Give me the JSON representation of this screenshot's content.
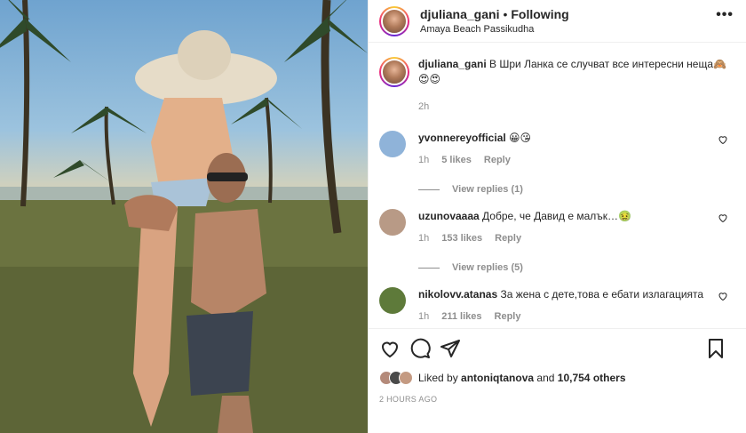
{
  "post": {
    "username": "djuliana_gani",
    "dot": "•",
    "follow_label": "Following",
    "location": "Amaya Beach Passikudha",
    "more_label": "•••",
    "caption_user": "djuliana_gani",
    "caption_text": "В Шри Ланка се случват все интересни неща🙈😍😍",
    "caption_time": "2h"
  },
  "comments": [
    {
      "user": "yvonnereyofficial",
      "text": "😀😘",
      "time": "1h",
      "likes": "5 likes",
      "reply": "Reply",
      "view_replies": "View replies (1)",
      "avatar_color": "#8fb3d9"
    },
    {
      "user": "uzunovaaaa",
      "text": "Добре, че Давид е малък…🤢",
      "time": "1h",
      "likes": "153 likes",
      "reply": "Reply",
      "view_replies": "View replies (5)",
      "avatar_color": "#b89a86"
    },
    {
      "user": "nikolovv.atanas",
      "text": "За жена с дете,това е ебати излагацията",
      "time": "1h",
      "likes": "211 likes",
      "reply": "Reply",
      "avatar_color": "#5e7a3a"
    }
  ],
  "actions": {
    "icons": [
      "heart-icon",
      "comment-icon",
      "share-icon",
      "bookmark-icon"
    ]
  },
  "likes": {
    "prefix": "Liked by",
    "user": "antoniqtanova",
    "connector": "and",
    "others": "10,754 others"
  },
  "timestamp": "2 HOURS AGO",
  "colors": {
    "text": "#262626",
    "muted": "#8e8e8e",
    "border": "#efefef"
  }
}
